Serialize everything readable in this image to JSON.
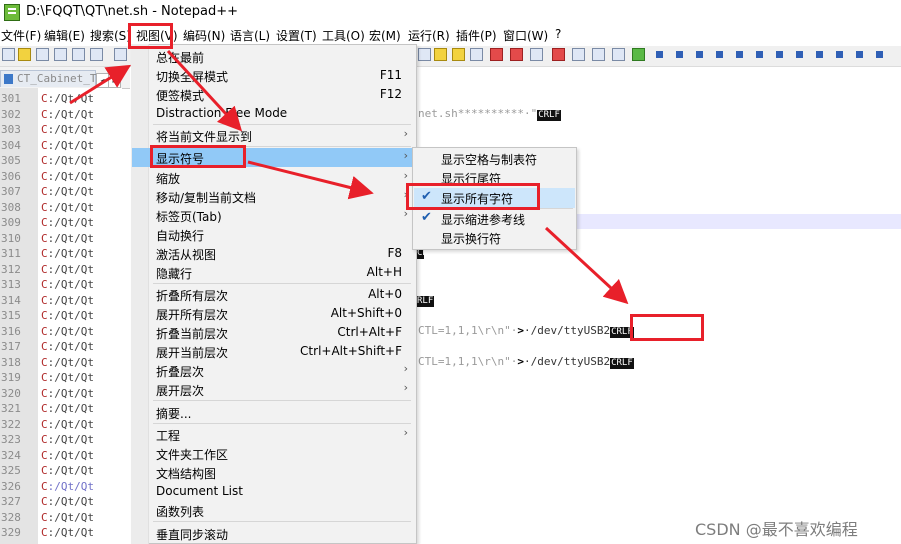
{
  "window": {
    "title": "D:\\FQQT\\QT\\net.sh - Notepad++"
  },
  "menubar": [
    "文件(F)",
    "编辑(E)",
    "搜索(S)",
    "视图(V)",
    "编码(N)",
    "语言(L)",
    "设置(T)",
    "工具(O)",
    "宏(M)",
    "运行(R)",
    "插件(P)",
    "窗口(W)",
    "?"
  ],
  "tab": {
    "label": "CT_Cabinet_Te"
  },
  "tab_nav": [
    "◂",
    "▸"
  ],
  "editor": {
    "line_numbers": [
      "301",
      "302",
      "303",
      "304",
      "305",
      "306",
      "307",
      "308",
      "309",
      "310",
      "311",
      "312",
      "313",
      "314",
      "315",
      "316",
      "317",
      "318",
      "319",
      "320",
      "321",
      "322",
      "323",
      "324",
      "325",
      "326",
      "327",
      "328",
      "329"
    ],
    "left_text": [
      "C:/Qt/Qt",
      "C:/Qt/Qt",
      "C:/Qt/Qt",
      "C:/Qt/Qt",
      "C:/Qt/Qt",
      "C:/Qt/Qt",
      "C:/Qt/Qt",
      "C:/Qt/Qt",
      "C:/Qt/Qt",
      "C:/Qt/Qt",
      "C:/Qt/Qt",
      "C:/Qt/Qt",
      "C:/Qt/Qt",
      "C:/Qt/Qt",
      "C:/Qt/Qt",
      "C:/Qt/Qt",
      "C:/Qt/Qt",
      "C:/Qt/Qt",
      "C:/Qt/Qt",
      "C:/Qt/Qt",
      "C:/Qt/Qt",
      "C:/Qt/Qt",
      "C:/Qt/Qt",
      "C:/Qt/Qt",
      "C:/Qt/Qt",
      "C:/Qt/Qt",
      "C:/Qt/Qt",
      "C:/Qt/Qt",
      "C:/Qt/Qt"
    ],
    "frag1_text": "net.sh**********·\"",
    "frag1_eol": "CRLF",
    "frag2_eol": "CRLF",
    "frag3_eol": "RLF",
    "frag4_text": "CTL=1,1,1\\r\\n\"·",
    "frag4_op": ">",
    "frag4_path": "·/dev/ttyUSB2",
    "frag4_eol": "CRLF",
    "frag5_text": "CTL=1,1,1\\r\\n\"·",
    "frag5_op": ">",
    "frag5_path": "·/dev/ttyUSB2",
    "frag5_eol": "CRLF"
  },
  "view_menu": {
    "items": [
      {
        "label": "总在最前",
        "shortcut": ""
      },
      {
        "label": "切换全屏模式",
        "shortcut": "F11"
      },
      {
        "label": "便签模式",
        "shortcut": "F12"
      },
      {
        "label": "Distraction Free Mode",
        "shortcut": ""
      },
      {
        "label": "将当前文件显示到",
        "shortcut": ""
      },
      {
        "label": "显示符号",
        "shortcut": ""
      },
      {
        "label": "缩放",
        "shortcut": ""
      },
      {
        "label": "移动/复制当前文档",
        "shortcut": ""
      },
      {
        "label": "标签页(Tab)",
        "shortcut": ""
      },
      {
        "label": "自动换行",
        "shortcut": ""
      },
      {
        "label": "激活从视图",
        "shortcut": "F8"
      },
      {
        "label": "隐藏行",
        "shortcut": "Alt+H"
      },
      {
        "label": "折叠所有层次",
        "shortcut": "Alt+0"
      },
      {
        "label": "展开所有层次",
        "shortcut": "Alt+Shift+0"
      },
      {
        "label": "折叠当前层次",
        "shortcut": "Ctrl+Alt+F"
      },
      {
        "label": "展开当前层次",
        "shortcut": "Ctrl+Alt+Shift+F"
      },
      {
        "label": "折叠层次",
        "shortcut": ""
      },
      {
        "label": "展开层次",
        "shortcut": ""
      },
      {
        "label": "摘要...",
        "shortcut": ""
      },
      {
        "label": "工程",
        "shortcut": ""
      },
      {
        "label": "文件夹工作区",
        "shortcut": ""
      },
      {
        "label": "文档结构图",
        "shortcut": ""
      },
      {
        "label": "Document List",
        "shortcut": ""
      },
      {
        "label": "函数列表",
        "shortcut": ""
      },
      {
        "label": "垂直同步滚动",
        "shortcut": ""
      }
    ],
    "submenu_arrow": "›"
  },
  "symbol_submenu": {
    "items": [
      {
        "label": "显示空格与制表符",
        "checked": false
      },
      {
        "label": "显示行尾符",
        "checked": false
      },
      {
        "label": "显示所有字符",
        "checked": true
      },
      {
        "label": "显示缩进参考线",
        "checked": true
      },
      {
        "label": "显示换行符",
        "checked": false
      }
    ],
    "check_mark": "✔"
  },
  "watermark": "CSDN @最不喜欢编程",
  "colors": {
    "highlight": "#91c9f7",
    "annotation_red": "#e8202a",
    "crlf_bg": "#111111"
  }
}
